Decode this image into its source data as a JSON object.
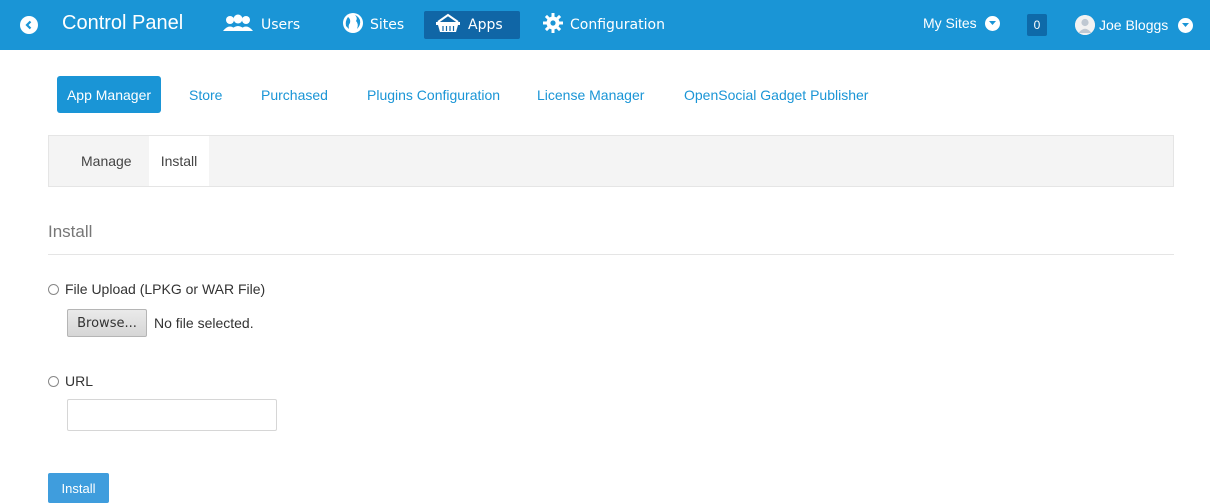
{
  "colors": {
    "accent": "#1a95d6",
    "active_nav": "#1066a6",
    "tabbar_bg": "#f4f4f4"
  },
  "dockbar": {
    "back_icon": "chevron-left-circle-icon",
    "title": "Control Panel",
    "nav": [
      {
        "label": "Users",
        "icon": "users-icon"
      },
      {
        "label": "Sites",
        "icon": "globe-icon"
      },
      {
        "label": "Apps",
        "icon": "basket-icon",
        "active": true
      },
      {
        "label": "Configuration",
        "icon": "gear-icon"
      }
    ],
    "my_sites": "My Sites",
    "notification_count": "0",
    "user_name": "Joe Bloggs"
  },
  "subnav": {
    "items": [
      {
        "label": "App Manager",
        "active": true
      },
      {
        "label": "Store"
      },
      {
        "label": "Purchased"
      },
      {
        "label": "Plugins Configuration"
      },
      {
        "label": "License Manager"
      },
      {
        "label": "OpenSocial Gadget Publisher"
      }
    ]
  },
  "tabs": [
    {
      "label": "Manage"
    },
    {
      "label": "Install",
      "active": true
    }
  ],
  "install_form": {
    "section_title": "Install",
    "file_upload_label": "File Upload (LPKG or WAR File)",
    "browse_label": "Browse...",
    "file_status": "No file selected.",
    "url_label": "URL",
    "url_value": "",
    "submit_label": "Install"
  }
}
